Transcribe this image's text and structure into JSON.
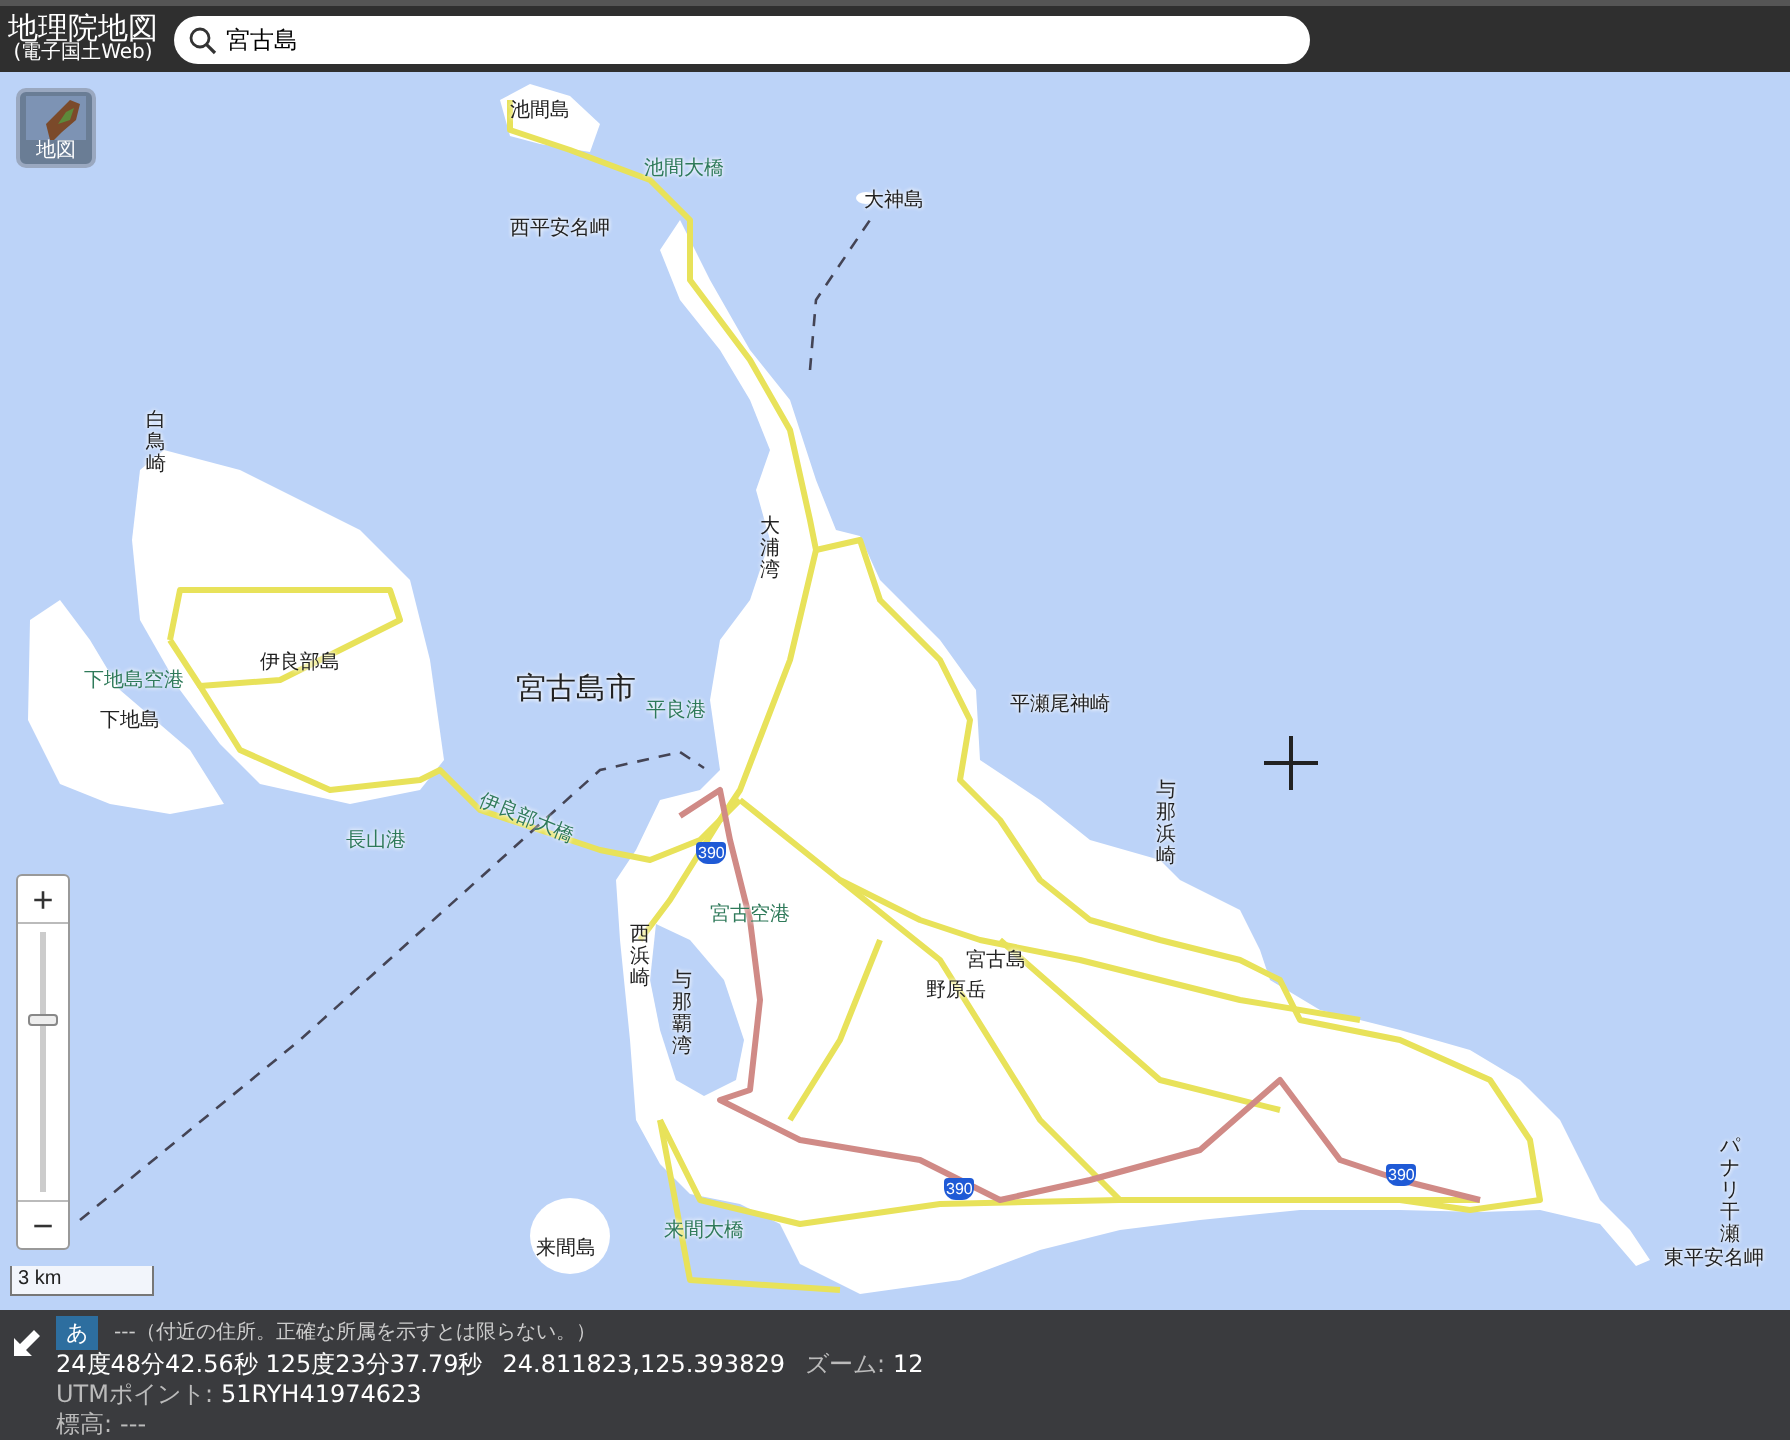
{
  "header": {
    "logo_title": "地理院地図",
    "logo_subtitle": "(電子国土Web)",
    "search": {
      "value": "宮古島"
    }
  },
  "map": {
    "layer_button": "地図",
    "labels": [
      {
        "text": "池間島",
        "kind": "place",
        "vertical": false
      },
      {
        "text": "池間大橋",
        "kind": "facility",
        "vertical": false
      },
      {
        "text": "大神島",
        "kind": "place",
        "vertical": false
      },
      {
        "text": "西平安名岬",
        "kind": "place",
        "vertical": false
      },
      {
        "text": "白鳥崎",
        "kind": "place",
        "vertical": true
      },
      {
        "text": "大浦湾",
        "kind": "place",
        "vertical": true
      },
      {
        "text": "伊良部島",
        "kind": "place",
        "vertical": false
      },
      {
        "text": "下地島空港",
        "kind": "facility",
        "vertical": false
      },
      {
        "text": "宮古島市",
        "kind": "city",
        "vertical": false
      },
      {
        "text": "下地島",
        "kind": "place",
        "vertical": false
      },
      {
        "text": "平良港",
        "kind": "facility",
        "vertical": false
      },
      {
        "text": "平瀬尾神崎",
        "kind": "place",
        "vertical": false
      },
      {
        "text": "与那浜崎",
        "kind": "place",
        "vertical": true
      },
      {
        "text": "伊良部大橋",
        "kind": "facility",
        "vertical": false
      },
      {
        "text": "長山港",
        "kind": "facility",
        "vertical": false
      },
      {
        "text": "宮古空港",
        "kind": "facility",
        "vertical": false
      },
      {
        "text": "西浜崎",
        "kind": "place",
        "vertical": true
      },
      {
        "text": "与那覇湾",
        "kind": "place",
        "vertical": true
      },
      {
        "text": "宮古島",
        "kind": "place",
        "vertical": false
      },
      {
        "text": "野原岳",
        "kind": "place",
        "vertical": false
      },
      {
        "text": "来間大橋",
        "kind": "facility",
        "vertical": false
      },
      {
        "text": "来間島",
        "kind": "place",
        "vertical": false
      },
      {
        "text": "パナリ干瀬",
        "kind": "place",
        "vertical": true
      },
      {
        "text": "東平安名岬",
        "kind": "place",
        "vertical": false
      }
    ],
    "route_shields": [
      "390",
      "390",
      "390"
    ],
    "zoom": {
      "in": "+",
      "out": "−",
      "level": 0.65
    },
    "scale": "3 km"
  },
  "info": {
    "lang_button": "あ",
    "address": "---（付近の住所。正確な所属を示すとは限らない。）",
    "dms": "24度48分42.56秒 125度23分37.79秒",
    "decimal": "24.811823,125.393829",
    "zoom_label": "ズーム:",
    "zoom_value": "12",
    "utm_label": "UTMポイント:",
    "utm_value": "51RYH41974623",
    "elevation_label": "標高:",
    "elevation_value": "---"
  }
}
